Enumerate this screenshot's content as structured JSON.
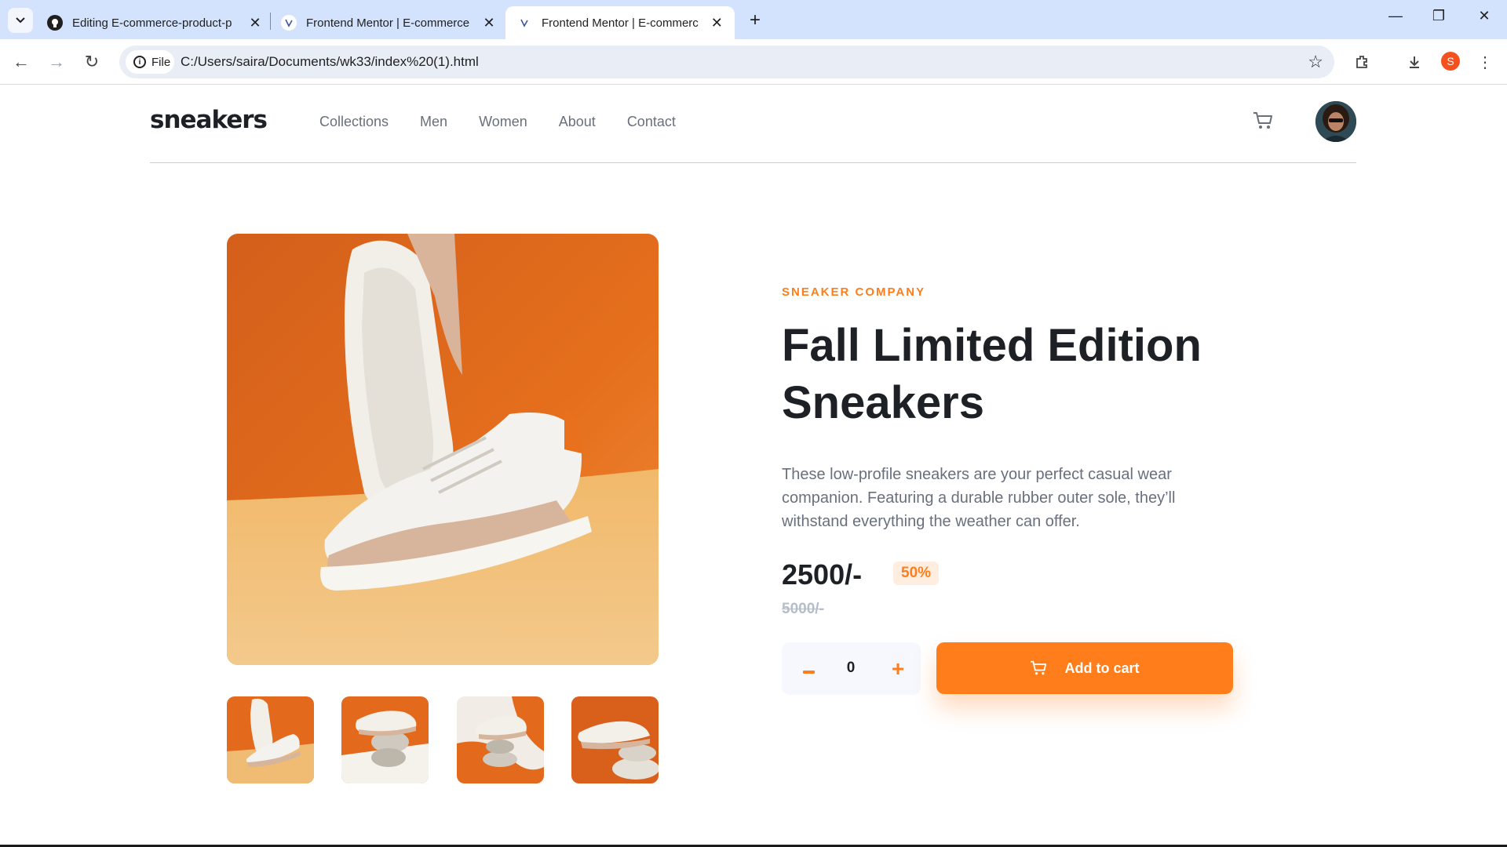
{
  "browser": {
    "tabs": [
      {
        "title": "Editing E-commerce-product-p",
        "favicon": "github-icon"
      },
      {
        "title": "Frontend Mentor | E-commerce",
        "favicon": "frontend-mentor-icon"
      },
      {
        "title": "Frontend Mentor | E-commerce",
        "favicon": "frontend-mentor-icon",
        "active": true
      }
    ],
    "chip_label": "File",
    "url": "C:/Users/saira/Documents/wk33/index%20(1).html",
    "profile_initial": "S"
  },
  "site": {
    "logo": "sneakers",
    "nav": [
      "Collections",
      "Men",
      "Women",
      "About",
      "Contact"
    ]
  },
  "product": {
    "company": "SNEAKER COMPANY",
    "title": "Fall Limited Edition Sneakers",
    "description": "These low-profile sneakers are your perfect casual wear companion. Featuring a durable rubber outer sole, they’ll withstand everything the weather can offer.",
    "price": "2500/-",
    "discount": "50%",
    "old_price": "5000/-",
    "quantity": "0",
    "add_to_cart_label": "Add to cart"
  },
  "colors": {
    "accent": "#ff7e1b",
    "accent_pale": "#ffede0",
    "text_dark": "#1d2025",
    "text_grey": "#69707d"
  }
}
